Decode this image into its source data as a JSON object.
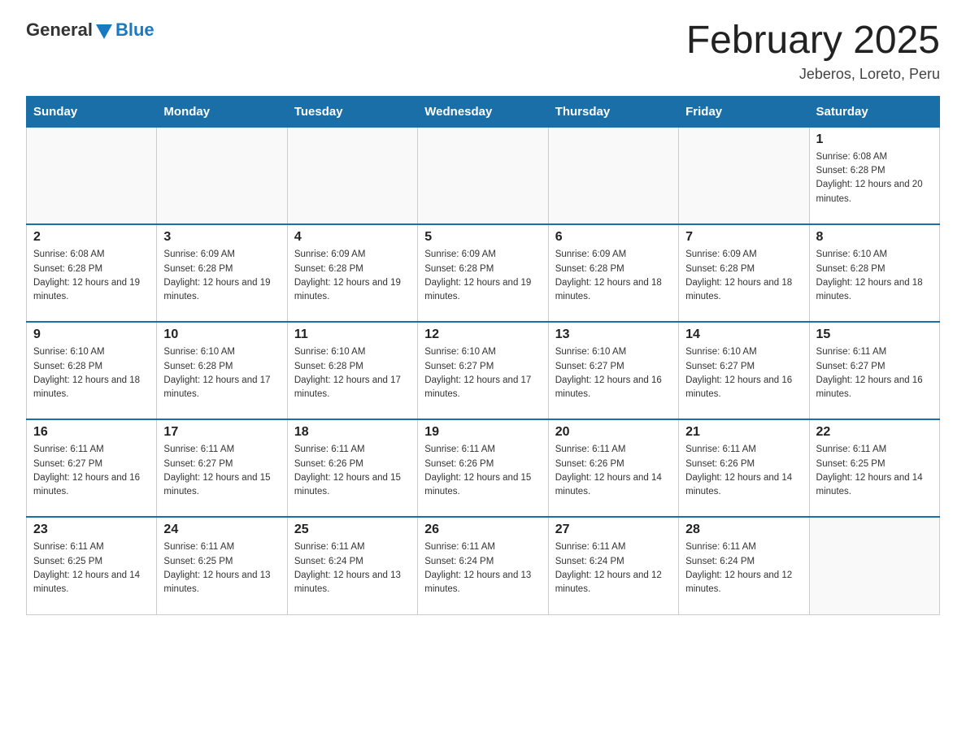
{
  "header": {
    "logo_general": "General",
    "logo_blue": "Blue",
    "month_title": "February 2025",
    "location": "Jeberos, Loreto, Peru"
  },
  "days_of_week": [
    "Sunday",
    "Monday",
    "Tuesday",
    "Wednesday",
    "Thursday",
    "Friday",
    "Saturday"
  ],
  "weeks": [
    [
      {
        "day": "",
        "sunrise": "",
        "sunset": "",
        "daylight": ""
      },
      {
        "day": "",
        "sunrise": "",
        "sunset": "",
        "daylight": ""
      },
      {
        "day": "",
        "sunrise": "",
        "sunset": "",
        "daylight": ""
      },
      {
        "day": "",
        "sunrise": "",
        "sunset": "",
        "daylight": ""
      },
      {
        "day": "",
        "sunrise": "",
        "sunset": "",
        "daylight": ""
      },
      {
        "day": "",
        "sunrise": "",
        "sunset": "",
        "daylight": ""
      },
      {
        "day": "1",
        "sunrise": "Sunrise: 6:08 AM",
        "sunset": "Sunset: 6:28 PM",
        "daylight": "Daylight: 12 hours and 20 minutes."
      }
    ],
    [
      {
        "day": "2",
        "sunrise": "Sunrise: 6:08 AM",
        "sunset": "Sunset: 6:28 PM",
        "daylight": "Daylight: 12 hours and 19 minutes."
      },
      {
        "day": "3",
        "sunrise": "Sunrise: 6:09 AM",
        "sunset": "Sunset: 6:28 PM",
        "daylight": "Daylight: 12 hours and 19 minutes."
      },
      {
        "day": "4",
        "sunrise": "Sunrise: 6:09 AM",
        "sunset": "Sunset: 6:28 PM",
        "daylight": "Daylight: 12 hours and 19 minutes."
      },
      {
        "day": "5",
        "sunrise": "Sunrise: 6:09 AM",
        "sunset": "Sunset: 6:28 PM",
        "daylight": "Daylight: 12 hours and 19 minutes."
      },
      {
        "day": "6",
        "sunrise": "Sunrise: 6:09 AM",
        "sunset": "Sunset: 6:28 PM",
        "daylight": "Daylight: 12 hours and 18 minutes."
      },
      {
        "day": "7",
        "sunrise": "Sunrise: 6:09 AM",
        "sunset": "Sunset: 6:28 PM",
        "daylight": "Daylight: 12 hours and 18 minutes."
      },
      {
        "day": "8",
        "sunrise": "Sunrise: 6:10 AM",
        "sunset": "Sunset: 6:28 PM",
        "daylight": "Daylight: 12 hours and 18 minutes."
      }
    ],
    [
      {
        "day": "9",
        "sunrise": "Sunrise: 6:10 AM",
        "sunset": "Sunset: 6:28 PM",
        "daylight": "Daylight: 12 hours and 18 minutes."
      },
      {
        "day": "10",
        "sunrise": "Sunrise: 6:10 AM",
        "sunset": "Sunset: 6:28 PM",
        "daylight": "Daylight: 12 hours and 17 minutes."
      },
      {
        "day": "11",
        "sunrise": "Sunrise: 6:10 AM",
        "sunset": "Sunset: 6:28 PM",
        "daylight": "Daylight: 12 hours and 17 minutes."
      },
      {
        "day": "12",
        "sunrise": "Sunrise: 6:10 AM",
        "sunset": "Sunset: 6:27 PM",
        "daylight": "Daylight: 12 hours and 17 minutes."
      },
      {
        "day": "13",
        "sunrise": "Sunrise: 6:10 AM",
        "sunset": "Sunset: 6:27 PM",
        "daylight": "Daylight: 12 hours and 16 minutes."
      },
      {
        "day": "14",
        "sunrise": "Sunrise: 6:10 AM",
        "sunset": "Sunset: 6:27 PM",
        "daylight": "Daylight: 12 hours and 16 minutes."
      },
      {
        "day": "15",
        "sunrise": "Sunrise: 6:11 AM",
        "sunset": "Sunset: 6:27 PM",
        "daylight": "Daylight: 12 hours and 16 minutes."
      }
    ],
    [
      {
        "day": "16",
        "sunrise": "Sunrise: 6:11 AM",
        "sunset": "Sunset: 6:27 PM",
        "daylight": "Daylight: 12 hours and 16 minutes."
      },
      {
        "day": "17",
        "sunrise": "Sunrise: 6:11 AM",
        "sunset": "Sunset: 6:27 PM",
        "daylight": "Daylight: 12 hours and 15 minutes."
      },
      {
        "day": "18",
        "sunrise": "Sunrise: 6:11 AM",
        "sunset": "Sunset: 6:26 PM",
        "daylight": "Daylight: 12 hours and 15 minutes."
      },
      {
        "day": "19",
        "sunrise": "Sunrise: 6:11 AM",
        "sunset": "Sunset: 6:26 PM",
        "daylight": "Daylight: 12 hours and 15 minutes."
      },
      {
        "day": "20",
        "sunrise": "Sunrise: 6:11 AM",
        "sunset": "Sunset: 6:26 PM",
        "daylight": "Daylight: 12 hours and 14 minutes."
      },
      {
        "day": "21",
        "sunrise": "Sunrise: 6:11 AM",
        "sunset": "Sunset: 6:26 PM",
        "daylight": "Daylight: 12 hours and 14 minutes."
      },
      {
        "day": "22",
        "sunrise": "Sunrise: 6:11 AM",
        "sunset": "Sunset: 6:25 PM",
        "daylight": "Daylight: 12 hours and 14 minutes."
      }
    ],
    [
      {
        "day": "23",
        "sunrise": "Sunrise: 6:11 AM",
        "sunset": "Sunset: 6:25 PM",
        "daylight": "Daylight: 12 hours and 14 minutes."
      },
      {
        "day": "24",
        "sunrise": "Sunrise: 6:11 AM",
        "sunset": "Sunset: 6:25 PM",
        "daylight": "Daylight: 12 hours and 13 minutes."
      },
      {
        "day": "25",
        "sunrise": "Sunrise: 6:11 AM",
        "sunset": "Sunset: 6:24 PM",
        "daylight": "Daylight: 12 hours and 13 minutes."
      },
      {
        "day": "26",
        "sunrise": "Sunrise: 6:11 AM",
        "sunset": "Sunset: 6:24 PM",
        "daylight": "Daylight: 12 hours and 13 minutes."
      },
      {
        "day": "27",
        "sunrise": "Sunrise: 6:11 AM",
        "sunset": "Sunset: 6:24 PM",
        "daylight": "Daylight: 12 hours and 12 minutes."
      },
      {
        "day": "28",
        "sunrise": "Sunrise: 6:11 AM",
        "sunset": "Sunset: 6:24 PM",
        "daylight": "Daylight: 12 hours and 12 minutes."
      },
      {
        "day": "",
        "sunrise": "",
        "sunset": "",
        "daylight": ""
      }
    ]
  ]
}
